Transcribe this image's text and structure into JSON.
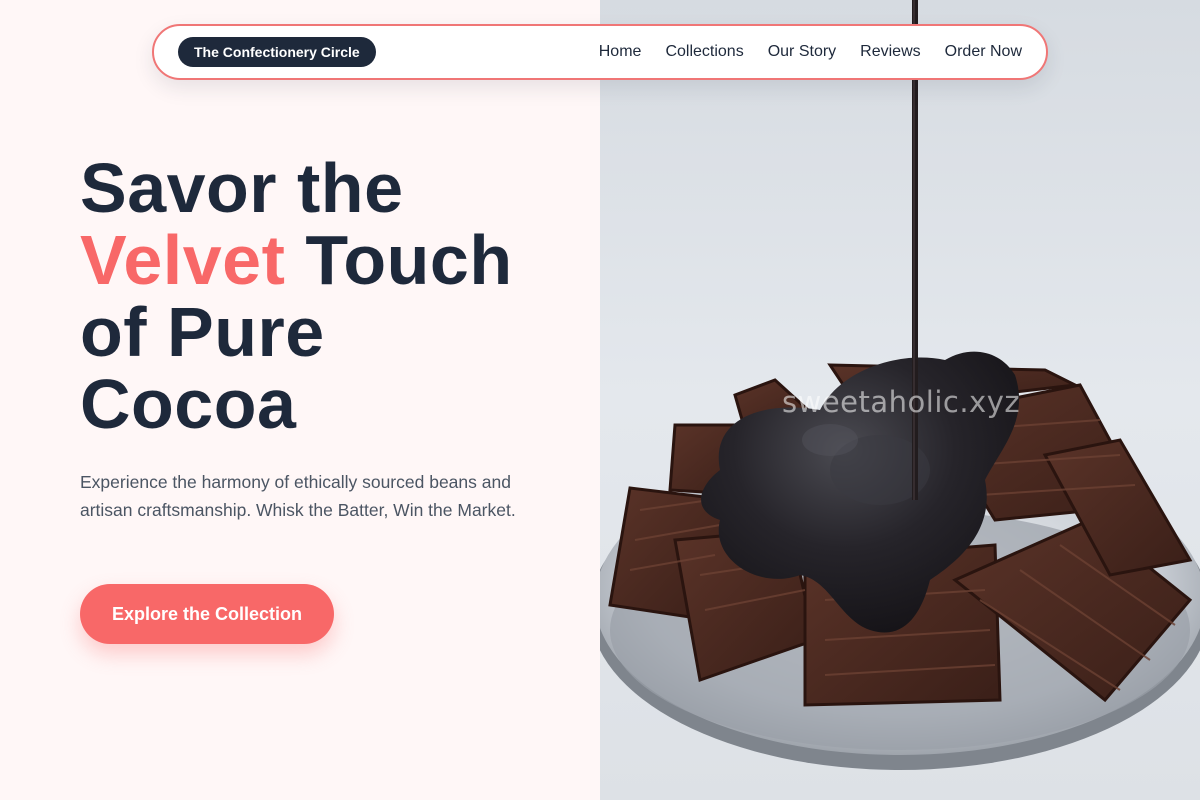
{
  "nav": {
    "brand": "The Confectionery Circle",
    "links": [
      "Home",
      "Collections",
      "Our Story",
      "Reviews",
      "Order Now"
    ]
  },
  "hero": {
    "title_line1": "Savor the",
    "title_accent": "Velvet",
    "title_line2_rest": " Touch",
    "title_line3": "of Pure",
    "title_line4": "Cocoa",
    "description": "Experience the harmony of ethically sourced beans and artisan craftsmanship. Whisk the Batter, Win the Market.",
    "cta_label": "Explore the Collection"
  },
  "image": {
    "subject": "chocolate-pieces-with-melted-chocolate-drizzle",
    "watermark": "sweetaholic.xyz"
  },
  "colors": {
    "primary_dark": "#1e293b",
    "accent": "#f86868",
    "background": "#fff7f7"
  }
}
